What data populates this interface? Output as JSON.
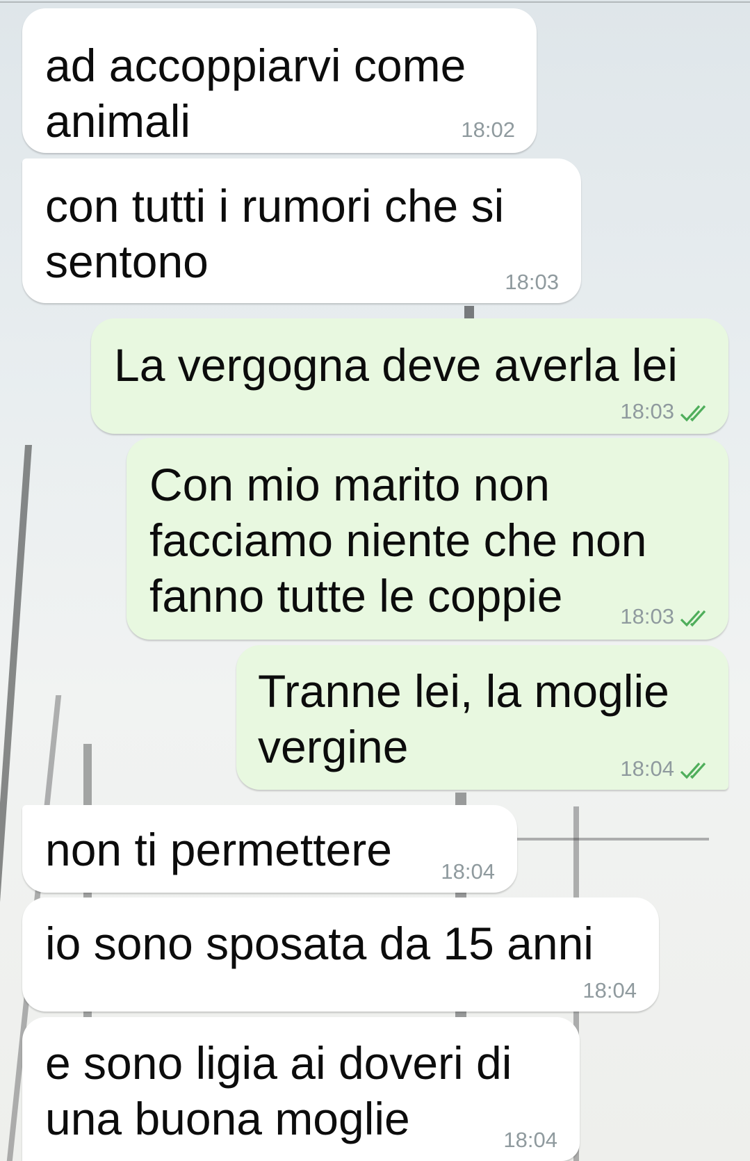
{
  "messages": [
    {
      "direction": "incoming",
      "text": "ad accoppiarvi come\nanimali",
      "time": "18:02"
    },
    {
      "direction": "incoming",
      "text": "con tutti i rumori che si\nsentono",
      "time": "18:03"
    },
    {
      "direction": "outgoing",
      "text": "La vergogna deve averla lei",
      "time": "18:03",
      "status": "read"
    },
    {
      "direction": "outgoing",
      "text": "Con mio marito non\nfacciamo niente che non\nfanno tutte le coppie",
      "time": "18:03",
      "status": "read"
    },
    {
      "direction": "outgoing",
      "text": "Tranne lei, la moglie\nvergine",
      "time": "18:04",
      "status": "read"
    },
    {
      "direction": "incoming",
      "text": "non ti permettere",
      "time": "18:04"
    },
    {
      "direction": "incoming",
      "text": "io sono sposata da 15 anni",
      "time": "18:04"
    },
    {
      "direction": "incoming",
      "text": "e sono ligia ai doveri di\nuna buona moglie",
      "time": "18:04"
    }
  ],
  "colors": {
    "incoming_bubble": "#ffffff",
    "outgoing_bubble": "#e8f8e0",
    "timestamp": "#8f9a9e",
    "read_ticks": "#4fae5b"
  },
  "icons": {
    "read_receipt": "double-check-icon"
  }
}
